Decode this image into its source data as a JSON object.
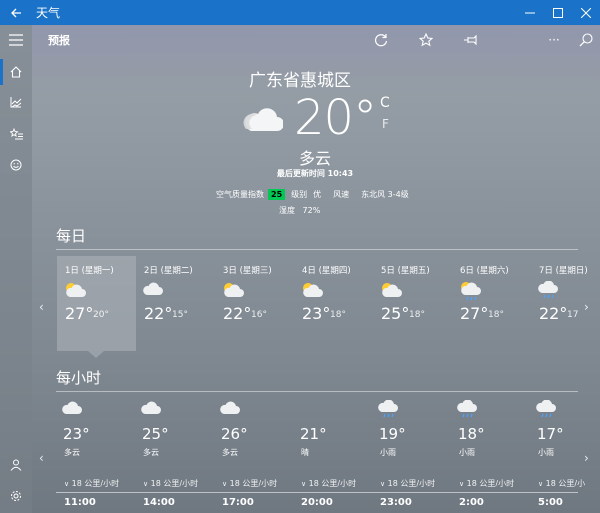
{
  "app": {
    "title": "天气"
  },
  "toolbar": {
    "label": "预报"
  },
  "current": {
    "location": "广东省惠城区",
    "temperature": "20°",
    "unit_c": "C",
    "unit_f": "F",
    "condition": "多云",
    "updated": "最后更新时间 10:43",
    "aqi_label": "空气质量指数",
    "aqi_value": "25",
    "level_label": "级别",
    "level_value": "优",
    "wind_label": "风速",
    "wind_value": "东北风 3-4级",
    "humidity_label": "湿度",
    "humidity_value": "72%"
  },
  "daily": {
    "heading": "每日",
    "days": [
      {
        "label": "1日 (星期一)",
        "high": "27°",
        "low": "20°",
        "icon": "partly-sunny-icon"
      },
      {
        "label": "2日 (星期二)",
        "high": "22°",
        "low": "15°",
        "icon": "cloudy-icon"
      },
      {
        "label": "3日 (星期三)",
        "high": "22°",
        "low": "16°",
        "icon": "partly-sunny-icon"
      },
      {
        "label": "4日 (星期四)",
        "high": "23°",
        "low": "18°",
        "icon": "partly-sunny-icon"
      },
      {
        "label": "5日 (星期五)",
        "high": "25°",
        "low": "18°",
        "icon": "partly-sunny-icon"
      },
      {
        "label": "6日 (星期六)",
        "high": "27°",
        "low": "18°",
        "icon": "sunny-rain-icon"
      },
      {
        "label": "7日 (星期日)",
        "high": "22°",
        "low": "17",
        "icon": "rain-icon"
      }
    ]
  },
  "hourly": {
    "heading": "每小时",
    "hours": [
      {
        "temp": "23°",
        "cond": "多云",
        "wind": "18 公里/小时",
        "time": "11:00",
        "icon": "cloudy-icon"
      },
      {
        "temp": "25°",
        "cond": "多云",
        "wind": "18 公里/小时",
        "time": "14:00",
        "icon": "cloudy-icon"
      },
      {
        "temp": "26°",
        "cond": "多云",
        "wind": "18 公里/小时",
        "time": "17:00",
        "icon": "cloudy-icon"
      },
      {
        "temp": "21°",
        "cond": "晴",
        "wind": "18 公里/小时",
        "time": "20:00",
        "icon": "moon-icon"
      },
      {
        "temp": "19°",
        "cond": "小雨",
        "wind": "18 公里/小时",
        "time": "23:00",
        "icon": "rain-icon"
      },
      {
        "temp": "18°",
        "cond": "小雨",
        "wind": "18 公里/小时",
        "time": "2:00",
        "icon": "rain-icon"
      },
      {
        "temp": "17°",
        "cond": "小雨",
        "wind": "18 公里/小",
        "time": "5:00",
        "icon": "rain-icon"
      }
    ]
  },
  "colors": {
    "accent": "#1a73c8",
    "aqi_good": "#00c853"
  }
}
